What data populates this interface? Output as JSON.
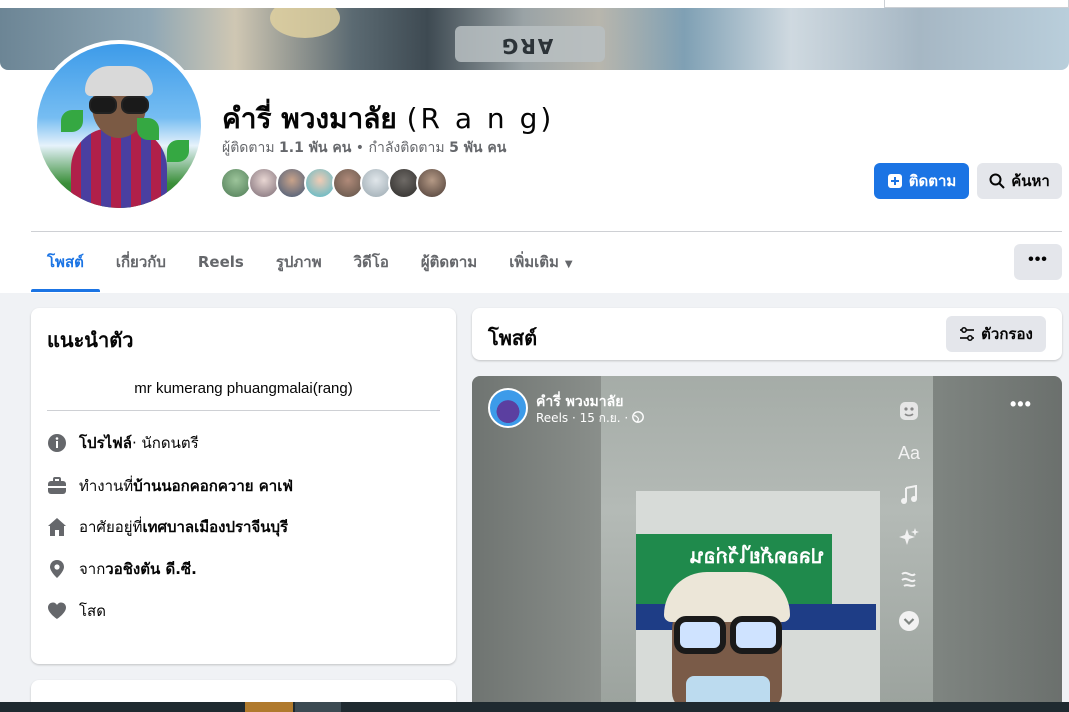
{
  "profile": {
    "name": "คำรี่ พวงมาลัย",
    "alt_name": "(R a n g)",
    "followers_label": "ผู้ติดตาม",
    "followers_count": "1.1 พัน คน",
    "separator": " • ",
    "following_label": "กำลังติดตาม",
    "following_count": "5 พัน คน",
    "cover_text": "ARG"
  },
  "actions": {
    "follow": "ติดตาม",
    "search": "ค้นหา",
    "more": "•••"
  },
  "tabs": [
    {
      "label": "โพสต์",
      "active": true
    },
    {
      "label": "เกี่ยวกับ"
    },
    {
      "label": "Reels"
    },
    {
      "label": "รูปภาพ"
    },
    {
      "label": "วิดีโอ"
    },
    {
      "label": "ผู้ติดตาม"
    },
    {
      "label": "เพิ่มเติม"
    }
  ],
  "intro": {
    "title": "แนะนำตัว",
    "bio": "mr kumerang phuangmalai(rang)",
    "profile_label": "โปรไฟล์",
    "profile_value": " · นักดนตรี",
    "work_prefix": "ทำงานที่ ",
    "work_value": "บ้านนอกคอกควาย คาเฟ่",
    "lives_prefix": "อาศัยอยู่ที่ ",
    "lives_value": "เทศบาลเมืองปราจีนบุรี",
    "from_prefix": "จาก ",
    "from_value": "วอชิงตัน ดี.ซี.",
    "relationship": "โสด"
  },
  "posts": {
    "title": "โพสต์",
    "filter": "ตัวกรอง",
    "post_author": "คำรี่ พวงมาลัย",
    "post_meta": "Reels · 15 ก.ย. ·",
    "post_more": "•••",
    "tool_text": "Aa",
    "sign_text": "ปลอดภัยไว้ก่อน"
  },
  "colors": {
    "accent": "#1b74e4",
    "background": "#f0f2f5",
    "card": "#ffffff",
    "muted_text": "#65676b"
  }
}
